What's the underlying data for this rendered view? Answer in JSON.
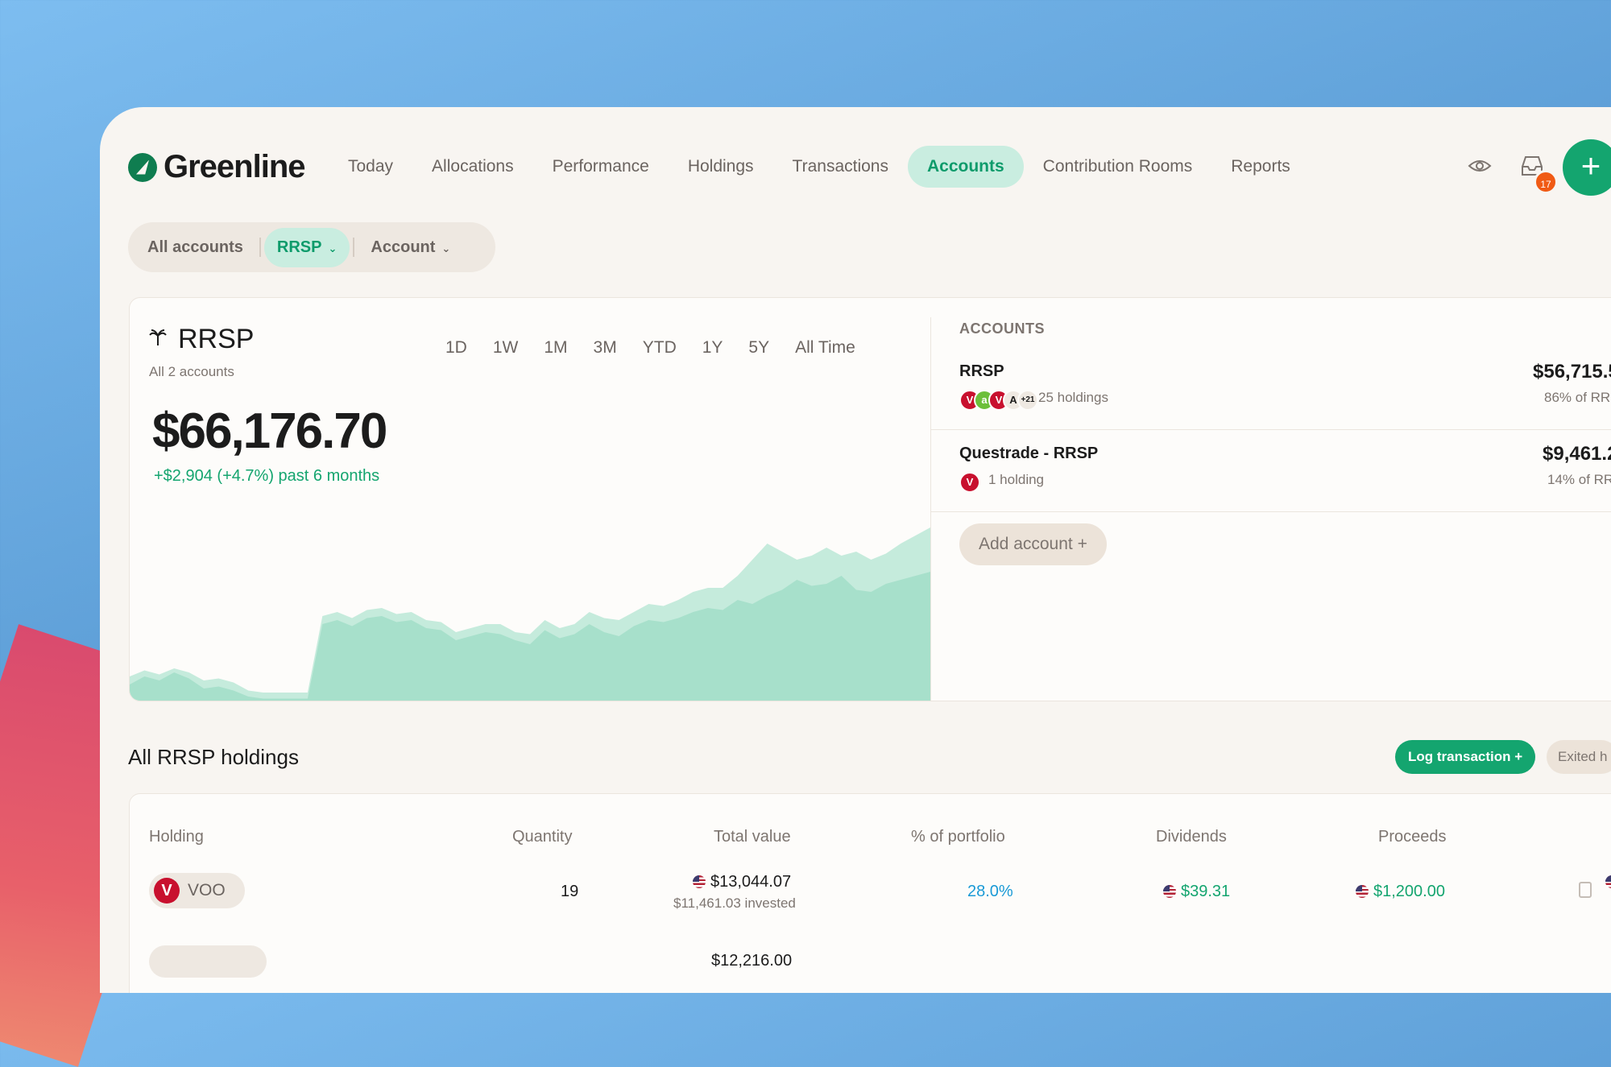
{
  "app": {
    "name": "Greenline",
    "inbox_count": "17",
    "add_label": "+"
  },
  "nav": {
    "items": [
      "Today",
      "Allocations",
      "Performance",
      "Holdings",
      "Transactions",
      "Accounts",
      "Contribution Rooms",
      "Reports"
    ],
    "active": "Accounts"
  },
  "filter": {
    "all": "All accounts",
    "type": "RRSP",
    "account": "Account"
  },
  "summary": {
    "title": "RRSP",
    "subtitle": "All 2 accounts",
    "value": "$66,176.70",
    "change": "+$2,904 (+4.7%)  past 6 months",
    "ranges": [
      "1D",
      "1W",
      "1M",
      "3M",
      "YTD",
      "1Y",
      "5Y",
      "All Time"
    ]
  },
  "chart_data": {
    "type": "area",
    "series": [
      {
        "values": [
          8,
          12,
          10,
          14,
          11,
          6,
          7,
          5,
          2,
          1,
          1,
          1,
          1,
          38,
          40,
          37,
          41,
          42,
          39,
          40,
          36,
          35,
          30,
          32,
          34,
          33,
          30,
          28,
          35,
          31,
          33,
          38,
          34,
          32,
          37,
          40,
          39,
          41,
          44,
          46,
          45,
          50,
          48,
          52,
          55,
          60,
          57,
          58,
          62,
          55,
          54,
          58,
          60,
          62,
          64
        ]
      },
      {
        "values": [
          12,
          15,
          13,
          16,
          14,
          10,
          11,
          9,
          5,
          4,
          4,
          4,
          4,
          42,
          44,
          41,
          45,
          46,
          43,
          44,
          40,
          39,
          34,
          36,
          38,
          38,
          34,
          33,
          40,
          36,
          38,
          44,
          41,
          40,
          44,
          48,
          47,
          50,
          54,
          56,
          56,
          62,
          70,
          78,
          74,
          70,
          72,
          76,
          72,
          74,
          70,
          73,
          78,
          82,
          86
        ]
      }
    ],
    "colors": [
      "#a7e0cb",
      "#c5ebdc"
    ]
  },
  "accounts": {
    "heading": "ACCOUNTS",
    "rows": [
      {
        "name": "RRSP",
        "meta": "25 holdings",
        "extra": "+21",
        "value": "$56,715.5",
        "pct": "86% of RR"
      },
      {
        "name": "Questrade - RRSP",
        "meta": "1 holding",
        "value": "$9,461.2",
        "pct": "14% of RR"
      }
    ],
    "add_label": "Add account  +"
  },
  "holdings": {
    "title": "All RRSP holdings",
    "log_label": "Log transaction  +",
    "exited_label": "Exited h",
    "columns": [
      "Holding",
      "Quantity",
      "Total value",
      "% of portfolio",
      "Dividends",
      "Proceeds"
    ],
    "rows": [
      {
        "ticker": "VOO",
        "quantity": "19",
        "total_value": "$13,044.07",
        "invested": "$11,461.03 invested",
        "pct": "28.0%",
        "dividends": "$39.31",
        "proceeds": "$1,200.00",
        "partial": "+$"
      },
      {
        "total_value": "$12,216.00"
      }
    ]
  }
}
